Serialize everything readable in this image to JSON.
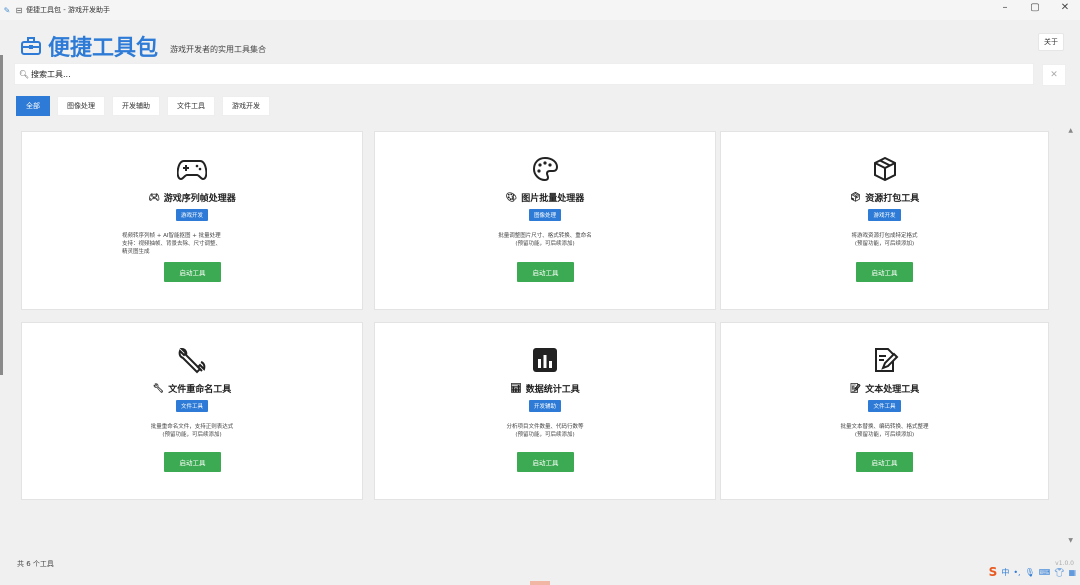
{
  "window": {
    "title": "便捷工具包 - 游戏开发助手",
    "controls": [
      "–",
      "▢",
      "✕"
    ]
  },
  "header": {
    "title": "便捷工具包",
    "subtitle": "游戏开发者的实用工具集合",
    "about_label": "关于"
  },
  "search": {
    "placeholder": "搜索工具...",
    "clear_label": "✕"
  },
  "tabs": [
    {
      "label": "全部",
      "active": true
    },
    {
      "label": "图像处理",
      "active": false
    },
    {
      "label": "开发辅助",
      "active": false
    },
    {
      "label": "文件工具",
      "active": false
    },
    {
      "label": "游戏开发",
      "active": false
    }
  ],
  "cards": [
    {
      "icon": "gamepad-icon",
      "name": "游戏序列帧处理器",
      "tag": "游戏开发",
      "desc": "视频转序列帧 + AI智能抠图 + 批量处理\n支持：视频抽帧、背景去除、尺寸调整、\n精灵图生成",
      "button": "启动工具"
    },
    {
      "icon": "palette-icon",
      "name": "图片批量处理器",
      "tag": "图像处理",
      "desc": "批量调整图片尺寸、格式转换、重命名\n(预留功能，可后续添加)",
      "button": "启动工具"
    },
    {
      "icon": "package-icon",
      "name": "资源打包工具",
      "tag": "游戏开发",
      "desc": "将游戏资源打包成特定格式\n(预留功能，可后续添加)",
      "button": "启动工具"
    },
    {
      "icon": "wrench-icon",
      "name": "文件重命名工具",
      "tag": "文件工具",
      "desc": "批量重命名文件，支持正则表达式\n(预留功能，可后续添加)",
      "button": "启动工具"
    },
    {
      "icon": "bar-chart-icon",
      "name": "数据统计工具",
      "tag": "开发辅助",
      "desc": "分析项目文件数量、代码行数等\n(预留功能，可后续添加)",
      "button": "启动工具"
    },
    {
      "icon": "document-edit-icon",
      "name": "文本处理工具",
      "tag": "文件工具",
      "desc": "批量文本替换、编码转换、格式整理\n(预留功能，可后续添加)",
      "button": "启动工具"
    }
  ],
  "footer": {
    "count": "共 6 个工具",
    "version": "v1.0.0"
  },
  "tray": {
    "ime": "S",
    "lang": "中"
  },
  "colors": {
    "accent": "#2d7bd6",
    "button_green": "#3caa52"
  }
}
